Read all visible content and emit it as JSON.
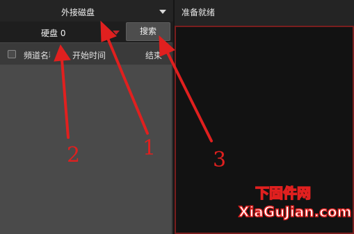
{
  "left": {
    "source_select": {
      "value": "外接磁盘"
    },
    "disk_select": {
      "value": "硬盘 0"
    },
    "search_label": "搜索",
    "table": {
      "columns": [
        "頻道名稱",
        "开始时间",
        "结束"
      ],
      "rows": []
    }
  },
  "right": {
    "status_text": "准备就绪"
  },
  "annotations": {
    "labels": [
      "1",
      "2",
      "3"
    ],
    "color": "#e0201f"
  },
  "watermark": {
    "line1": "下固件网",
    "line2": "XiaGuJian.com"
  },
  "colors": {
    "accent_red": "#c0262b",
    "panel_bg": "#262626",
    "table_body": "#4a4a4a",
    "preview_bg": "#121212"
  }
}
